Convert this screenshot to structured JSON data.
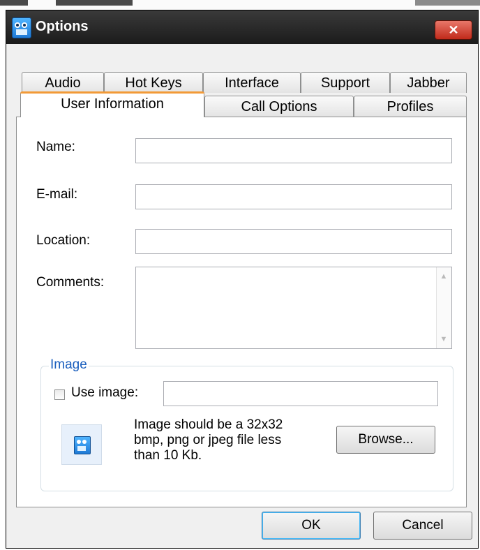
{
  "window": {
    "title": "Options",
    "close_glyph": "✕"
  },
  "tabs": {
    "row1": [
      "Audio",
      "Hot Keys",
      "Interface",
      "Support",
      "Jabber"
    ],
    "row2": [
      "User Information",
      "Call Options",
      "Profiles"
    ],
    "active": "User Information"
  },
  "form": {
    "name_label": "Name:",
    "name_value": "",
    "email_label": "E-mail:",
    "email_value": "",
    "location_label": "Location:",
    "location_value": "",
    "comments_label": "Comments:",
    "comments_value": ""
  },
  "image_group": {
    "title": "Image",
    "use_image_label": "Use image:",
    "use_image_checked": false,
    "path_value": "",
    "hint_lines": [
      "Image should be a 32x32",
      "bmp, png or jpeg file less",
      "than 10 Kb."
    ],
    "browse_label": "Browse..."
  },
  "buttons": {
    "ok_label": "OK",
    "cancel_label": "Cancel"
  },
  "colors": {
    "active_tab_accent": "#f29a37",
    "group_title": "#1b5fbe",
    "close_button": "#c12a1a"
  },
  "icons": {
    "app": "app-logo-icon",
    "close": "close-icon",
    "scroll_up": "scroll-up-arrow-icon",
    "scroll_down": "scroll-down-arrow-icon",
    "preview": "image-preview-icon"
  }
}
